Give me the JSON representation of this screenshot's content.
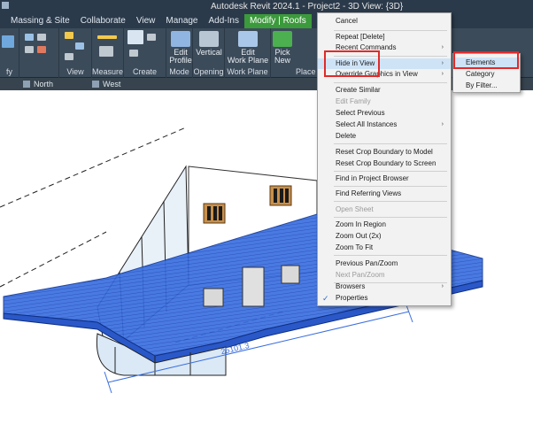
{
  "window": {
    "title": "Autodesk Revit 2024.1 - Project2 - 3D View: {3D}"
  },
  "menubar": {
    "tabs": [
      {
        "label": ""
      },
      {
        "label": "Massing & Site"
      },
      {
        "label": "Collaborate"
      },
      {
        "label": "View"
      },
      {
        "label": "Manage"
      },
      {
        "label": "Add-Ins"
      },
      {
        "label": "Modify | Roofs"
      }
    ]
  },
  "ribbon": {
    "groups": [
      {
        "label": "fy"
      },
      {
        "label": "View"
      },
      {
        "label": "Measure"
      },
      {
        "label": "Create"
      },
      {
        "label": "Mode"
      },
      {
        "label": "Opening"
      },
      {
        "label": "Work Plane"
      },
      {
        "label": "Place"
      }
    ],
    "buttons": {
      "edit_profile": {
        "line1": "Edit",
        "line2": "Profile"
      },
      "vertical": {
        "line1": "Vertical",
        "line2": ""
      },
      "edit_work_plane": {
        "line1": "Edit",
        "line2": "Work Plane"
      },
      "pick_new": {
        "line1": "Pick",
        "line2": "New"
      }
    }
  },
  "view_tabs": [
    {
      "label": "North"
    },
    {
      "label": "West"
    }
  ],
  "context_menu": {
    "items": [
      {
        "label": "Cancel",
        "state": "normal"
      },
      {
        "label": "Repeat [Delete]",
        "state": "normal"
      },
      {
        "label": "Recent Commands",
        "state": "normal",
        "arrow": "›"
      },
      {
        "label": "Hide in View",
        "state": "highlight",
        "arrow": "›"
      },
      {
        "label": "Override Graphics in View",
        "state": "normal",
        "arrow": "›"
      },
      {
        "label": "Create Similar",
        "state": "normal"
      },
      {
        "label": "Edit Family",
        "state": "disabled"
      },
      {
        "label": "Select Previous",
        "state": "normal"
      },
      {
        "label": "Select All Instances",
        "state": "normal",
        "arrow": "›"
      },
      {
        "label": "Delete",
        "state": "normal"
      },
      {
        "label": "Reset Crop Boundary to Model",
        "state": "normal"
      },
      {
        "label": "Reset Crop Boundary to Screen",
        "state": "normal"
      },
      {
        "label": "Find in Project Browser",
        "state": "normal"
      },
      {
        "label": "Find Referring Views",
        "state": "normal"
      },
      {
        "label": "Open Sheet",
        "state": "disabled"
      },
      {
        "label": "Zoom In Region",
        "state": "normal"
      },
      {
        "label": "Zoom Out (2x)",
        "state": "normal"
      },
      {
        "label": "Zoom To Fit",
        "state": "normal"
      },
      {
        "label": "Previous Pan/Zoom",
        "state": "normal"
      },
      {
        "label": "Next Pan/Zoom",
        "state": "disabled"
      },
      {
        "label": "Browsers",
        "state": "normal",
        "arrow": "›"
      },
      {
        "label": "Properties",
        "state": "normal",
        "checked": "✓"
      }
    ]
  },
  "submenu": {
    "items": [
      {
        "label": "Elements",
        "state": "highlight"
      },
      {
        "label": "Category",
        "state": "normal"
      },
      {
        "label": "By Filter...",
        "state": "normal"
      }
    ]
  },
  "canvas": {
    "dimension_label": "25101.3"
  },
  "colors": {
    "accent_green": "#3b9a3b",
    "selection_blue": "#2f5fd0",
    "highlight_red": "#e02a2a",
    "menu_hover": "#cfe3f7"
  }
}
